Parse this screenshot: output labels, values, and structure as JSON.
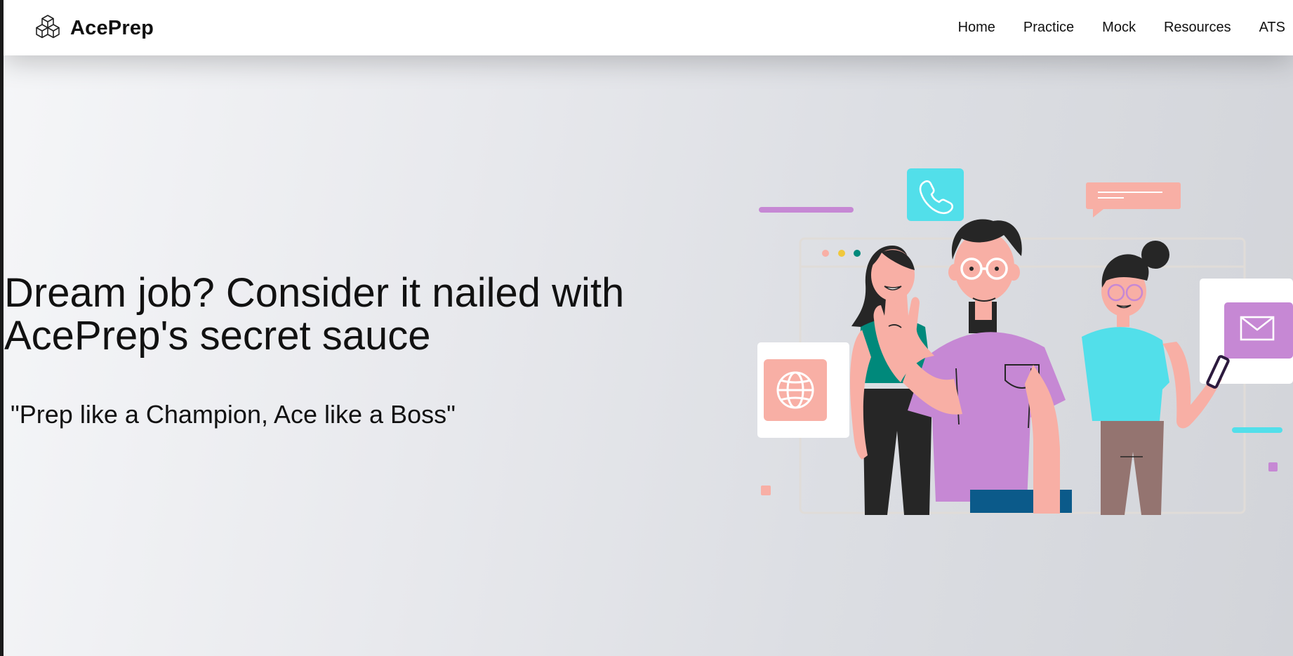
{
  "brand": {
    "name": "AcePrep",
    "icon": "cubes-logo-icon"
  },
  "nav": {
    "items": [
      {
        "label": "Home"
      },
      {
        "label": "Practice"
      },
      {
        "label": "Mock"
      },
      {
        "label": "Resources"
      },
      {
        "label": "ATS"
      }
    ]
  },
  "hero": {
    "headline_line1": "Dream job? Consider it nailed with",
    "headline_line2": "AcePrep's secret sauce",
    "tagline": "\"Prep like a Champion, Ace like a Boss\""
  },
  "illustration": {
    "subject": "three-people-waving-illustration",
    "icons": [
      "phone-icon",
      "globe-icon",
      "mail-icon",
      "chat-bubble-icon",
      "smartphone-icon"
    ],
    "colors": {
      "purple": "#c688d4",
      "cyan": "#52dfea",
      "salmon": "#f8afa5",
      "teal": "#00897b",
      "navy": "#0b5a8a",
      "taupe": "#947470",
      "hair": "#262626"
    }
  }
}
